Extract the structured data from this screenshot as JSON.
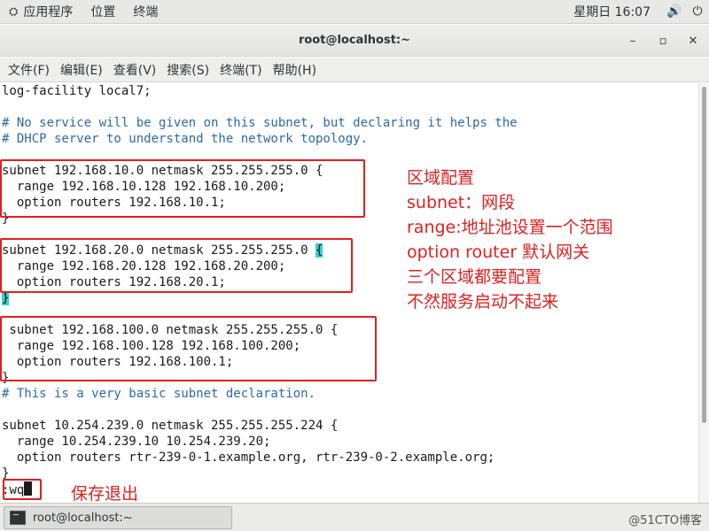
{
  "top_panel": {
    "apps_menu": "应用程序",
    "places_menu": "位置",
    "terminal_menu": "终端",
    "clock": "星期日 16:07",
    "volume_icon": "speaker-icon",
    "power_icon": "power-icon"
  },
  "window": {
    "title": "root@localhost:~",
    "minimize": "–",
    "maximize": "▫",
    "close": "✕"
  },
  "menubar": {
    "items": [
      "文件(F)",
      "编辑(E)",
      "查看(V)",
      "搜索(S)",
      "终端(T)",
      "帮助(H)"
    ]
  },
  "terminal": {
    "lines": [
      "log-facility local7;",
      "",
      "# No service will be given on this subnet, but declaring it helps the",
      "# DHCP server to understand the network topology.",
      "",
      "subnet 192.168.10.0 netmask 255.255.255.0 {",
      "  range 192.168.10.128 192.168.10.200;",
      "  option routers 192.168.10.1;",
      "}",
      "",
      "subnet 192.168.20.0 netmask 255.255.255.0 ",
      "  range 192.168.20.128 192.168.20.200;",
      "  option routers 192.168.20.1;",
      "",
      "",
      " subnet 192.168.100.0 netmask 255.255.255.0 {",
      "  range 192.168.100.128 192.168.100.200;",
      "  option routers 192.168.100.1;",
      "}",
      "# This is a very basic subnet declaration.",
      "",
      "subnet 10.254.239.0 netmask 255.255.255.224 {",
      "  range 10.254.239.10 10.254.239.20;",
      "  option routers rtr-239-0-1.example.org, rtr-239-0-2.example.org;",
      "}"
    ],
    "highlight_open_brace": "{",
    "highlight_close_brace": "}",
    "command_prompt": ":",
    "command_text": "wq"
  },
  "annotations": {
    "zone_notes": [
      "区域配置",
      "subnet：网段",
      "range:地址池设置一个范围",
      "option router 默认网关",
      "三个区域都要配置",
      "不然服务启动不起来"
    ],
    "save_note": "保存退出"
  },
  "taskbar": {
    "task_label": "root@localhost:~",
    "watermark": "@51CTO博客"
  },
  "colors": {
    "annotation_red": "#e02020",
    "comment_blue": "#2b6aa8",
    "brace_highlight": "#2ed3d3"
  }
}
